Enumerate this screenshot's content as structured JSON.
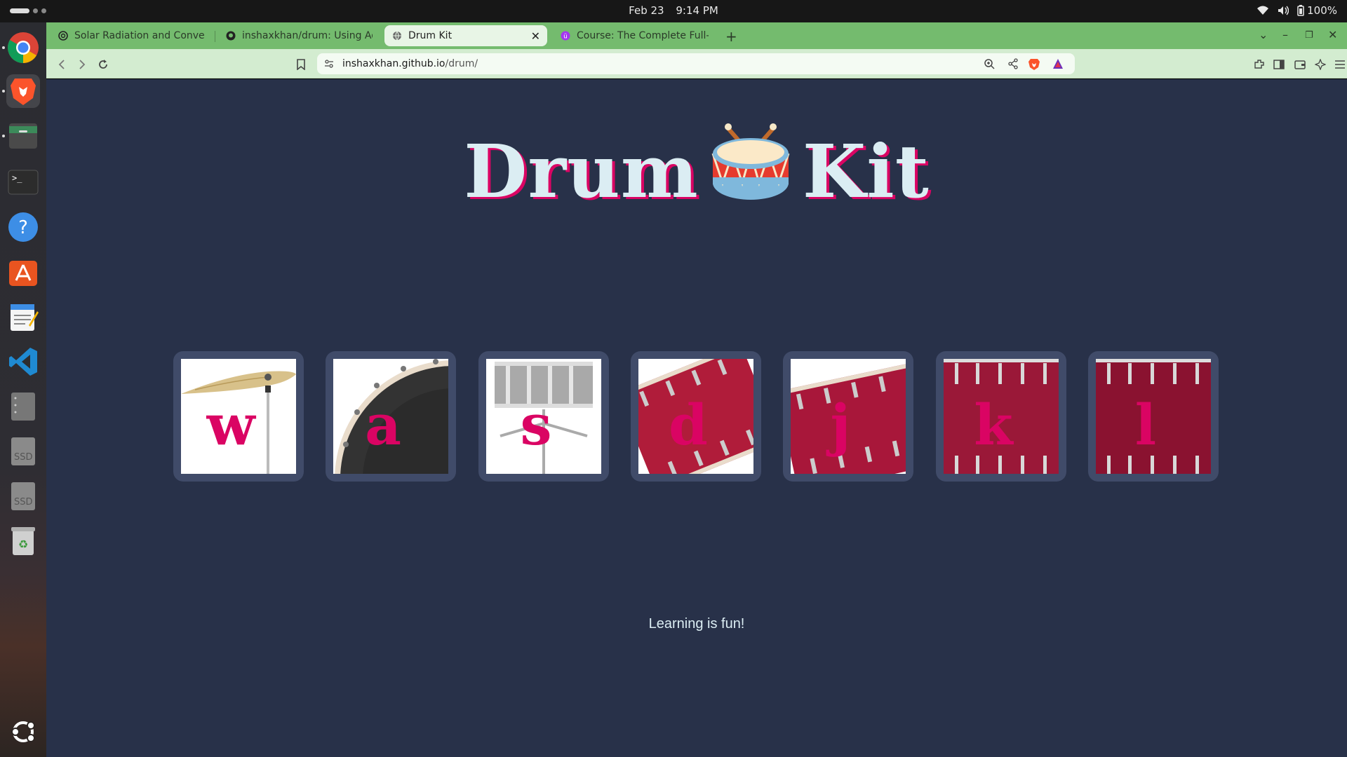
{
  "system_bar": {
    "date": "Feb 23",
    "time": "9:14 PM",
    "battery": "100%",
    "icons": [
      "wifi-icon",
      "volume-icon",
      "battery-icon"
    ]
  },
  "dock": {
    "items": [
      {
        "name": "chrome-icon"
      },
      {
        "name": "brave-icon"
      },
      {
        "name": "files-icon"
      },
      {
        "name": "terminal-icon"
      },
      {
        "name": "help-icon"
      },
      {
        "name": "app-center-icon"
      },
      {
        "name": "text-editor-icon"
      },
      {
        "name": "vscode-icon"
      },
      {
        "name": "disk-icon"
      },
      {
        "name": "ssd-drive-icon",
        "label": "SSD"
      },
      {
        "name": "ssd-drive-icon",
        "label": "SSD"
      },
      {
        "name": "trash-icon"
      },
      {
        "name": "ubuntu-apps-icon"
      }
    ]
  },
  "browser": {
    "tabs": [
      {
        "label": "Solar Radiation and Convers",
        "icon": "openai-icon",
        "active": false
      },
      {
        "label": "inshaxkhan/drum: Using Adv",
        "icon": "github-icon",
        "active": false
      },
      {
        "label": "Drum Kit",
        "icon": "globe-icon",
        "active": true
      },
      {
        "label": "Course: The Complete Full-S",
        "icon": "udemy-icon",
        "active": false
      }
    ],
    "url_host": "inshaxkhan.github.io",
    "url_path": "/drum/"
  },
  "page": {
    "title_left": "Drum",
    "title_emoji": "drum-emoji",
    "title_right": "Kit",
    "drums": [
      {
        "key": "w",
        "instrument": "crash"
      },
      {
        "key": "a",
        "instrument": "kick"
      },
      {
        "key": "s",
        "instrument": "snare"
      },
      {
        "key": "d",
        "instrument": "tom1"
      },
      {
        "key": "j",
        "instrument": "tom2"
      },
      {
        "key": "k",
        "instrument": "tom3"
      },
      {
        "key": "l",
        "instrument": "tom4"
      }
    ],
    "footer": "Learning is fun!",
    "colors": {
      "background": "#283149",
      "tile": "#404b69",
      "key": "#da0463",
      "title": "#dbedf3"
    }
  }
}
